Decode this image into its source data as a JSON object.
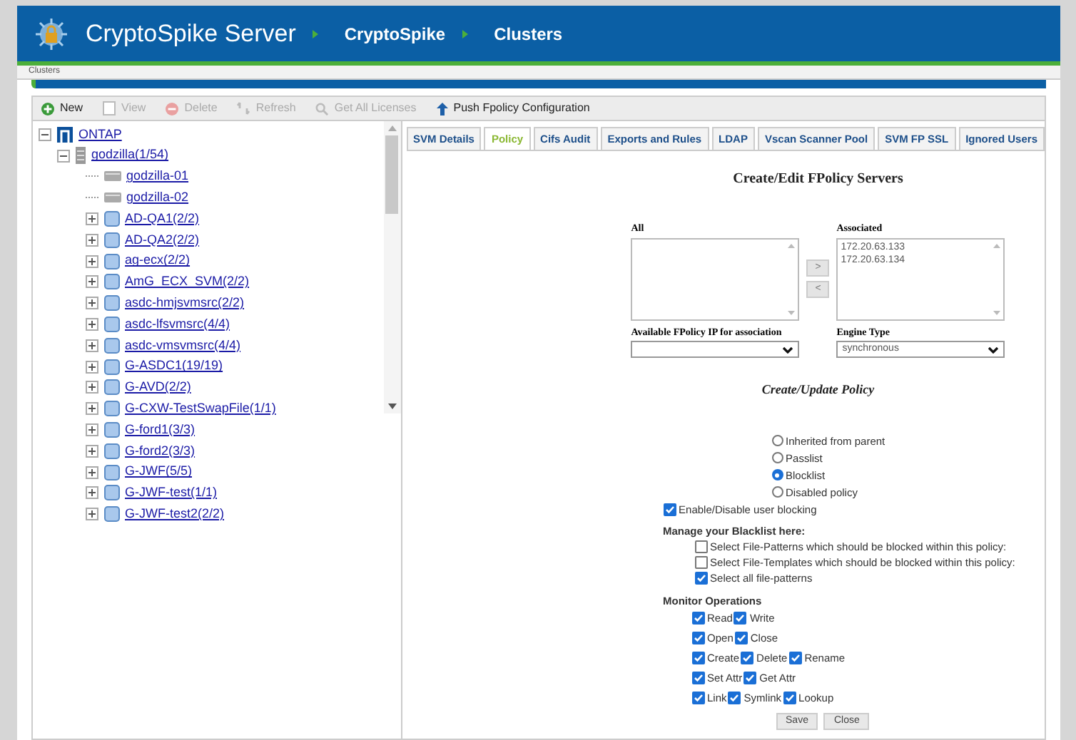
{
  "header": {
    "app_title": "CryptoSpike Server",
    "breadcrumbs": [
      "CryptoSpike",
      "Clusters"
    ]
  },
  "page_path": "Clusters",
  "toolbar": [
    {
      "label": "New",
      "disabled": false
    },
    {
      "label": "View",
      "disabled": true
    },
    {
      "label": "Delete",
      "disabled": true
    },
    {
      "label": "Refresh",
      "disabled": true
    },
    {
      "label": "Get All Licenses",
      "disabled": true
    },
    {
      "label": "Push Fpolicy Configuration",
      "disabled": false
    }
  ],
  "tree": [
    {
      "label": "ONTAP",
      "kind": "cluster",
      "expanded": true,
      "children": [
        {
          "label": "godzilla(1/54)",
          "kind": "server",
          "expanded": true,
          "children": [
            {
              "label": "godzilla-01",
              "kind": "node"
            },
            {
              "label": "godzilla-02",
              "kind": "node"
            },
            {
              "label": "AD-QA1(2/2)",
              "kind": "svm",
              "expanded": false
            },
            {
              "label": "AD-QA2(2/2)",
              "kind": "svm",
              "expanded": false
            },
            {
              "label": "ag-ecx(2/2)",
              "kind": "svm",
              "expanded": false
            },
            {
              "label": "AmG_ECX_SVM(2/2)",
              "kind": "svm",
              "expanded": false
            },
            {
              "label": "asdc-hmjsvmsrc(2/2)",
              "kind": "svm",
              "expanded": false
            },
            {
              "label": "asdc-lfsvmsrc(4/4)",
              "kind": "svm",
              "expanded": false
            },
            {
              "label": "asdc-vmsvmsrc(4/4)",
              "kind": "svm",
              "expanded": false
            },
            {
              "label": "G-ASDC1(19/19)",
              "kind": "svm",
              "expanded": false
            },
            {
              "label": "G-AVD(2/2)",
              "kind": "svm",
              "expanded": false
            },
            {
              "label": "G-CXW-TestSwapFile(1/1)",
              "kind": "svm",
              "expanded": false
            },
            {
              "label": "G-ford1(3/3)",
              "kind": "svm",
              "expanded": false
            },
            {
              "label": "G-ford2(3/3)",
              "kind": "svm",
              "expanded": false
            },
            {
              "label": "G-JWF(5/5)",
              "kind": "svm",
              "expanded": false
            },
            {
              "label": "G-JWF-test(1/1)",
              "kind": "svm",
              "expanded": false
            },
            {
              "label": "G-JWF-test2(2/2)",
              "kind": "svm",
              "expanded": false
            }
          ]
        }
      ]
    }
  ],
  "tabs": [
    {
      "label": "SVM Details",
      "selected": false
    },
    {
      "label": "Policy",
      "selected": true
    },
    {
      "label": "Cifs Audit",
      "selected": false
    },
    {
      "label": "Exports and Rules",
      "selected": false
    },
    {
      "label": "LDAP",
      "selected": false
    },
    {
      "label": "Vscan Scanner Pool",
      "selected": false
    },
    {
      "label": "SVM FP SSL",
      "selected": false
    },
    {
      "label": "Ignored Users",
      "selected": false
    }
  ],
  "servers": {
    "title": "Create/Edit FPolicy Servers",
    "all_label": "All",
    "move_right": ">",
    "move_left": "<",
    "associated_label": "Associated",
    "associated_items": [
      "172.20.63.133",
      "172.20.63.134"
    ],
    "available_label": "Available FPolicy IP for association",
    "engine_label": "Engine Type",
    "engine_value": "synchronous"
  },
  "policy": {
    "title": "Create/Update Policy",
    "modes": [
      {
        "label": "Inherited from parent",
        "selected": false
      },
      {
        "label": "Passlist",
        "selected": false
      },
      {
        "label": "Blocklist",
        "selected": true
      },
      {
        "label": "Disabled policy",
        "selected": false
      }
    ],
    "user_blocking": {
      "label": "Enable/Disable user blocking",
      "checked": true
    },
    "blacklist_heading": "Manage your Blacklist here:",
    "blacklist_options": [
      {
        "label": "Select File-Patterns which should be blocked within this policy:",
        "checked": false
      },
      {
        "label": "Select File-Templates which should be blocked within this policy:",
        "checked": false
      },
      {
        "label": "Select all file-patterns",
        "checked": true
      }
    ],
    "monitor_heading": "Monitor Operations",
    "operations": [
      [
        {
          "label": "Read",
          "checked": true
        },
        {
          "label": "Write",
          "checked": true
        }
      ],
      [
        {
          "label": "Open",
          "checked": true
        },
        {
          "label": "Close",
          "checked": true
        }
      ],
      [
        {
          "label": "Create",
          "checked": true
        },
        {
          "label": "Delete",
          "checked": true
        },
        {
          "label": "Rename",
          "checked": true
        }
      ],
      [
        {
          "label": "Set Attr",
          "checked": true
        },
        {
          "label": "Get Attr",
          "checked": true
        }
      ],
      [
        {
          "label": "Link",
          "checked": true
        },
        {
          "label": "Symlink",
          "checked": true
        },
        {
          "label": "Lookup",
          "checked": true
        }
      ]
    ],
    "buttons": [
      "Save",
      "Close"
    ]
  }
}
